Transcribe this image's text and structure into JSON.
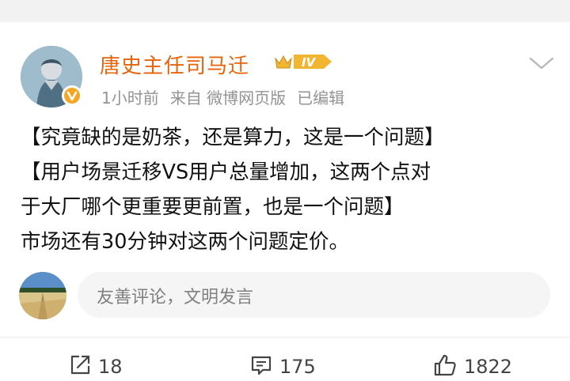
{
  "post": {
    "author": "唐史主任司马迁",
    "level": "IV",
    "time": "1小时前",
    "source": "来自 微博网页版",
    "edited": "已编辑",
    "content_lines": [
      "【究竟缺的是奶茶，还是算力，这是一个问题】",
      "【用户场景迁移VS用户总量增加，这两个点对",
      "于大厂哪个更重要更前置，也是一个问题】",
      "市场还有30分钟对这两个问题定价。"
    ]
  },
  "comment": {
    "placeholder": "友善评论，文明发言"
  },
  "actions": {
    "share_count": "18",
    "comment_count": "175",
    "like_count": "1822"
  },
  "colors": {
    "username": "#e8630a",
    "verified_badge": "#f5a623",
    "meta": "#939393"
  }
}
